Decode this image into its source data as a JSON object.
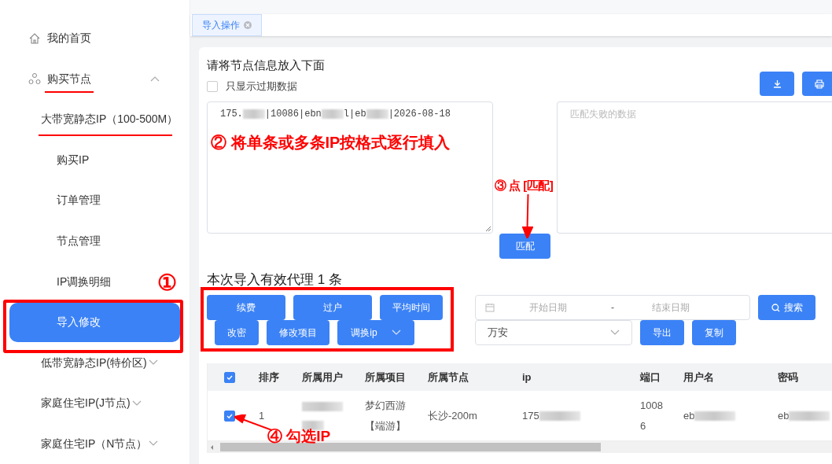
{
  "sidebar": {
    "items": [
      {
        "label": "我的首页"
      },
      {
        "label": "购买节点",
        "expanded": true,
        "children": [
          {
            "label": "大带宽静态IP（100-500M）",
            "children": [
              {
                "label": "购买IP",
                "selected": false
              },
              {
                "label": "订单管理",
                "selected": false
              },
              {
                "label": "节点管理",
                "selected": false
              },
              {
                "label": "IP调换明细",
                "selected": false
              },
              {
                "label": "导入修改",
                "selected": true
              }
            ]
          },
          {
            "label": "低带宽静态IP(特价区)",
            "expanded": false
          },
          {
            "label": "家庭住宅IP(J节点)",
            "expanded": false
          },
          {
            "label": "家庭住宅IP（N节点）",
            "expanded": false
          }
        ]
      }
    ]
  },
  "tabs": [
    {
      "label": "导入操作",
      "selected": true
    }
  ],
  "import_panel": {
    "title": "请将节点信息放入下面",
    "expired_only": {
      "label": "只显示过期数据",
      "checked": false
    },
    "input_segments": [
      {
        "text": "175.",
        "blurred": true
      },
      {
        "text": "|10086|ebn",
        "blurred": true
      },
      {
        "text": "l|eb",
        "blurred": true
      },
      {
        "text": "|2026-08-18"
      }
    ],
    "failed_placeholder": "匹配失败的数据",
    "match_button": "匹配"
  },
  "result": {
    "title": "本次导入有效代理 1 条",
    "actions": [
      {
        "label": "续费"
      },
      {
        "label": "过户"
      },
      {
        "label": "平均时间"
      },
      {
        "label": "改密"
      },
      {
        "label": "修改项目"
      },
      {
        "label": "调换ip",
        "dropdown": true
      }
    ],
    "date_range": {
      "start_placeholder": "开始日期",
      "separator": "-",
      "end_placeholder": "结束日期"
    },
    "search_button": "搜索",
    "region_select": "万安",
    "export_button": "导出",
    "copy_button": "复制"
  },
  "table": {
    "all_checked": true,
    "columns": [
      "排序",
      "所属用户",
      "所属项目",
      "所属节点",
      "ip",
      "端口",
      "用户名",
      "密码"
    ],
    "rows": [
      {
        "selected": true,
        "cells": [
          {
            "text": "1"
          },
          {
            "blurred": true
          },
          {
            "text": "梦幻西游【端游】"
          },
          {
            "text": "长沙-200m"
          },
          {
            "text": "175",
            "blurred": true
          },
          {
            "text": "10086"
          },
          {
            "text": "eb",
            "blurred": true
          },
          {
            "text": "eb",
            "blurred": true
          }
        ]
      }
    ]
  },
  "annotations": [
    "①",
    "② 将单条或多条IP按格式逐行填入",
    "③ 点 [匹配]",
    "④ 勾选IP"
  ]
}
